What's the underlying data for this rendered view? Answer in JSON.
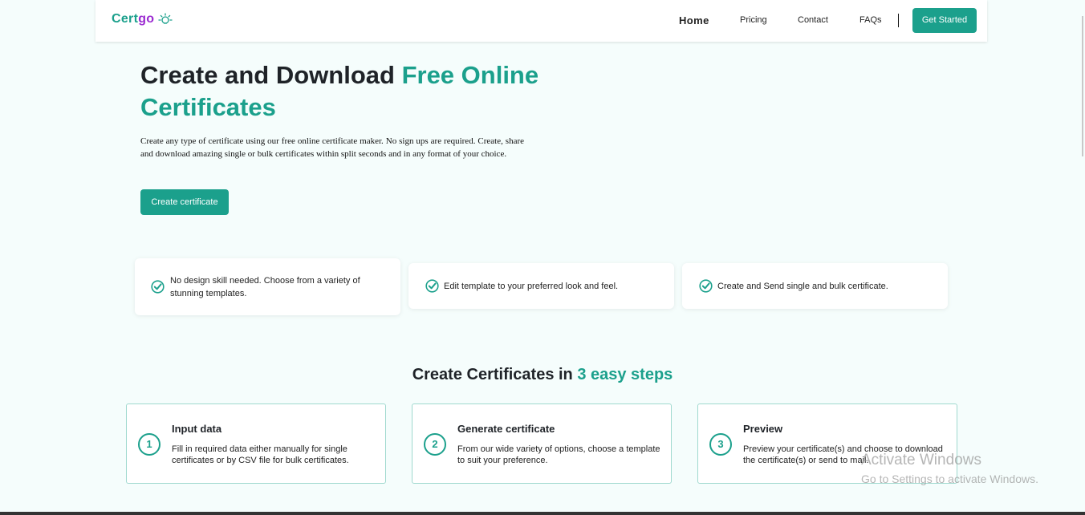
{
  "header": {
    "logo_part1": "Cert",
    "logo_part2": "go",
    "logo_icon": "lightbulb-icon",
    "nav": {
      "home": "Home",
      "pricing": "Pricing",
      "contact": "Contact",
      "faqs": "FAQs"
    },
    "cta": "Get Started"
  },
  "hero": {
    "title_main": "Create and Download",
    "title_accent": "Free Online Certificates",
    "description": "Create any type of certificate using our free online certificate maker. No sign ups are required. Create, share and download amazing single or bulk certificates within split seconds and in any format of your choice.",
    "button": "Create certificate"
  },
  "features": [
    {
      "icon": "check-circle-icon",
      "text": "No design skill needed. Choose from a variety of stunning templates."
    },
    {
      "icon": "check-circle-icon",
      "text": "Edit template to your preferred look and feel."
    },
    {
      "icon": "check-circle-icon",
      "text": "Create and Send single and bulk certificate."
    }
  ],
  "steps_section": {
    "title_main": "Create Certificates in",
    "title_accent": "3 easy steps",
    "steps": [
      {
        "number": "1",
        "title": "Input data",
        "description": "Fill in required data either manually for single certificates or by CSV file for bulk certificates."
      },
      {
        "number": "2",
        "title": "Generate certificate",
        "description": "From our wide variety of options, choose a template to suit your preference."
      },
      {
        "number": "3",
        "title": "Preview",
        "description": "Preview your certificate(s) and choose to download the certificate(s) or send to mail."
      }
    ]
  },
  "watermark": {
    "line1": "Activate Windows",
    "line2": "Go to Settings to activate Windows."
  },
  "colors": {
    "accent": "#1ba08c",
    "logo_go": "#9b2bd1",
    "background": "#f5fdfc"
  }
}
